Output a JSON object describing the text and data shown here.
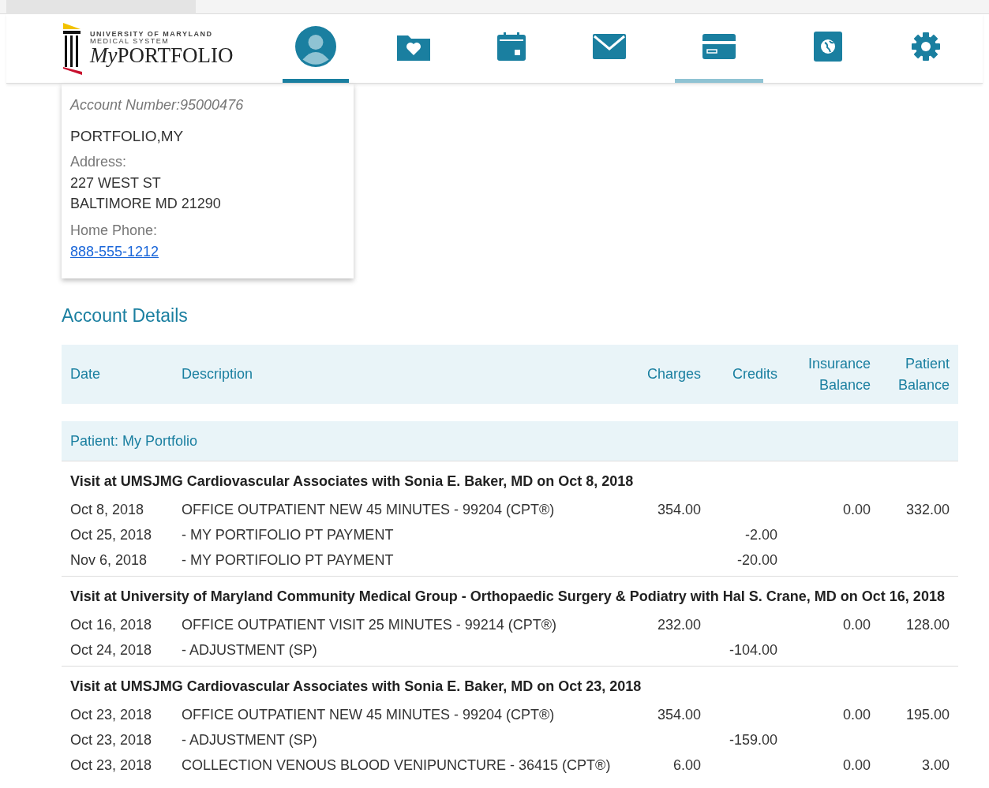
{
  "logo": {
    "org": "UNIVERSITY OF MARYLAND",
    "org_sub": "MEDICAL SYSTEM",
    "product_prefix": "My",
    "product": "PORTFOLIO"
  },
  "nav": [
    {
      "kind": "avatar",
      "selected": true
    },
    {
      "kind": "folder",
      "selected": false
    },
    {
      "kind": "calendar",
      "selected": false
    },
    {
      "kind": "mail",
      "selected": false
    },
    {
      "kind": "card",
      "selected": true
    },
    {
      "kind": "book",
      "selected": false
    },
    {
      "kind": "gear",
      "selected": false
    }
  ],
  "account": {
    "number": "Account Number:95000476",
    "name": "PORTFOLIO,MY",
    "address_label": "Address:",
    "address": [
      "227 WEST ST",
      "BALTIMORE MD 21290"
    ],
    "phone_label": "Home Phone:",
    "phone": "888-555-1212"
  },
  "section_title": "Account Details",
  "columns": [
    "Date",
    "Description",
    "Charges",
    "Credits",
    "Insurance Balance",
    "Patient Balance"
  ],
  "patient": "Patient: My Portfolio",
  "visits": [
    {
      "title": "Visit at UMSJMG Cardiovascular Associates with Sonia E. Baker, MD on Oct 8, 2018",
      "rows": [
        [
          "Oct 8, 2018",
          "OFFICE OUTPATIENT NEW 45 MINUTES - 99204 (CPT®)",
          "354.00",
          "",
          "0.00",
          "332.00"
        ],
        [
          "Oct 25, 2018",
          "- MY PORTIFOLIO PT PAYMENT",
          "",
          "-2.00",
          "",
          ""
        ],
        [
          "Nov 6, 2018",
          "- MY PORTIFOLIO PT PAYMENT",
          "",
          "-20.00",
          "",
          ""
        ]
      ]
    },
    {
      "title": "Visit at University of Maryland Community Medical Group - Orthopaedic Surgery & Podiatry with Hal S. Crane, MD on Oct 16, 2018",
      "rows": [
        [
          "Oct 16, 2018",
          "OFFICE OUTPATIENT VISIT 25 MINUTES - 99214 (CPT®)",
          "232.00",
          "",
          "0.00",
          "128.00"
        ],
        [
          "Oct 24, 2018",
          "- ADJUSTMENT (SP)",
          "",
          "-104.00",
          "",
          ""
        ]
      ]
    },
    {
      "title": "Visit at UMSJMG Cardiovascular Associates with Sonia E. Baker, MD on Oct 23, 2018",
      "rows": [
        [
          "Oct 23, 2018",
          "OFFICE OUTPATIENT NEW 45 MINUTES - 99204 (CPT®)",
          "354.00",
          "",
          "0.00",
          "195.00"
        ],
        [
          "Oct 23, 2018",
          "- ADJUSTMENT (SP)",
          "",
          "-159.00",
          "",
          ""
        ],
        [
          "Oct 23, 2018",
          "COLLECTION VENOUS BLOOD VENIPUNCTURE - 36415 (CPT®)",
          "6.00",
          "",
          "0.00",
          "3.00"
        ]
      ]
    }
  ]
}
